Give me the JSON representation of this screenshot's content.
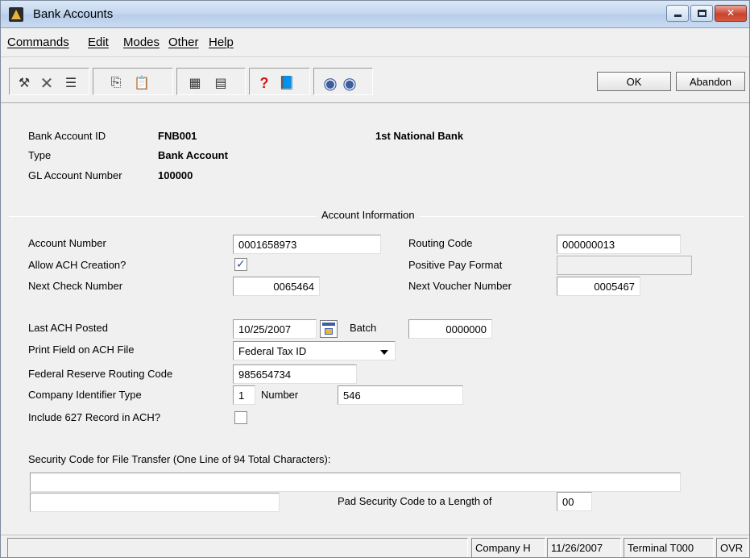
{
  "window": {
    "title": "Bank Accounts"
  },
  "menu": {
    "commands": "Commands",
    "edit": "Edit",
    "modes": "Modes",
    "other": "Other",
    "help": "Help"
  },
  "toolbar": {
    "ok_label": "OK",
    "abandon_label": "Abandon",
    "icons": [
      "tools-icon",
      "delete-icon",
      "list-icon",
      "copy-icon",
      "paste-icon",
      "calculator-icon",
      "calendar-icon",
      "help-icon",
      "book-icon",
      "globe-back-icon",
      "globe-forward-icon"
    ]
  },
  "header": {
    "bank_account_id_label": "Bank Account ID",
    "bank_account_id": "FNB001",
    "bank_name": "1st National Bank",
    "type_label": "Type",
    "type": "Bank Account",
    "gl_label": "GL Account Number",
    "gl_number": "100000"
  },
  "account_info": {
    "group_title": "Account Information",
    "account_number_label": "Account Number",
    "account_number": "0001658973",
    "routing_code_label": "Routing Code",
    "routing_code": "000000013",
    "allow_ach_label": "Allow ACH Creation?",
    "allow_ach": true,
    "positive_pay_label": "Positive Pay Format",
    "positive_pay": "",
    "next_check_label": "Next Check Number",
    "next_check": "0065464",
    "next_voucher_label": "Next Voucher Number",
    "next_voucher": "0005467",
    "last_ach_label": "Last ACH Posted",
    "last_ach": "10/25/2007",
    "batch_label": "Batch",
    "batch": "0000000",
    "print_field_label": "Print Field on ACH File",
    "print_field": "Federal Tax ID",
    "frb_routing_label": "Federal Reserve Routing Code",
    "frb_routing": "985654734",
    "company_id_type_label": "Company Identifier Type",
    "company_id_type": "1",
    "number_label": "Number",
    "number": "546",
    "include_627_label": "Include 627 Record in ACH?",
    "include_627": false,
    "security_code_label": "Security Code for File Transfer (One Line of 94 Total Characters):",
    "security_code_line1": "",
    "security_code_line2": "",
    "pad_label": "Pad Security Code to a Length of",
    "pad_length": "00"
  },
  "statusbar": {
    "message": "",
    "company": "Company H",
    "date": "11/26/2007",
    "terminal": "Terminal T000",
    "mode": "OVR"
  }
}
